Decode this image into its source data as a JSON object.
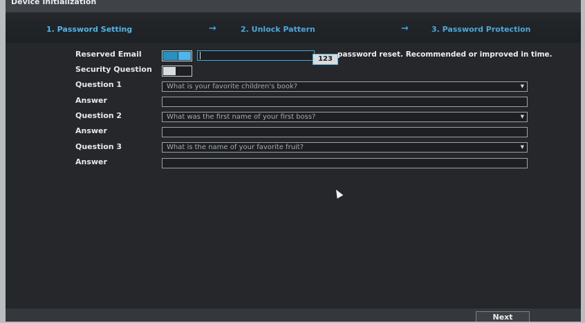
{
  "window": {
    "title": "Device Initialization"
  },
  "steps": [
    {
      "label": "1.  Password Setting"
    },
    {
      "label": "2.  Unlock Pattern"
    },
    {
      "label": "3.  Password Protection"
    }
  ],
  "step_arrow": "→",
  "form": {
    "reserved_email": {
      "label": "Reserved Email",
      "toggle": true,
      "value": "",
      "hint": "password reset. Recommended or improved in time."
    },
    "keyboard_button": "123",
    "security_question": {
      "label": "Security Question",
      "toggle": false
    },
    "q1": {
      "label": "Question 1",
      "value": "What is your favorite children's book?",
      "answer_label": "Answer",
      "answer_value": ""
    },
    "q2": {
      "label": "Question 2",
      "value": "What was the first name of your first boss?",
      "answer_label": "Answer",
      "answer_value": ""
    },
    "q3": {
      "label": "Question 3",
      "value": "What is the name of your favorite fruit?",
      "answer_label": "Answer",
      "answer_value": ""
    }
  },
  "buttons": {
    "next": "Next"
  },
  "icons": {
    "dropdown": "chevron-down-icon",
    "mouse": "mouse-pointer-icon"
  }
}
